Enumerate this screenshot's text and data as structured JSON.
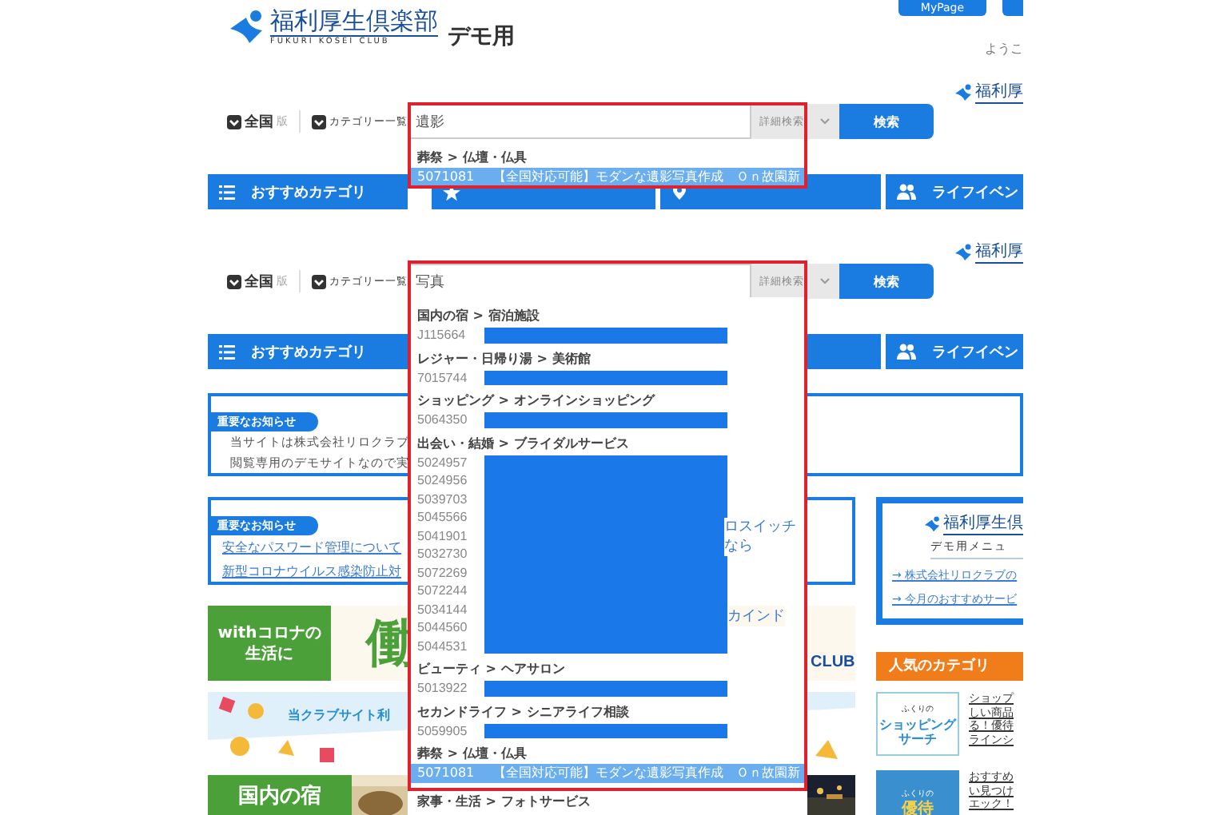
{
  "top": {
    "logo": {
      "name": "福利厚生倶楽部",
      "tagline": "FUKURI KOSEI CLUB"
    },
    "edition": "デモ用",
    "mypage": "MyPage",
    "greeting": "ようこ",
    "side_logo": "福利厚",
    "filters": [
      {
        "label": "全国",
        "suffix": "版"
      },
      {
        "label": "カテゴリー一覧"
      }
    ],
    "search": {
      "value": "遺影",
      "mode": "詳細検索",
      "button": "検索"
    },
    "suggestions": [
      {
        "heading": "葬祭 > 仏壇・仏具",
        "items": [
          {
            "code": "5071081",
            "title": "【全国対応可能】モダンな遺影写真作成　Ｏｎ故園新",
            "redacted": false,
            "selected": true
          }
        ]
      }
    ],
    "nav": {
      "labels": [
        "おすすめカテゴリ",
        "ライフイベン"
      ]
    }
  },
  "lower": {
    "side_logo": "福利厚",
    "filters": [
      {
        "label": "全国",
        "suffix": "版"
      },
      {
        "label": "カテゴリー一覧"
      }
    ],
    "search": {
      "value": "写真",
      "mode": "詳細検索",
      "button": "検索"
    },
    "suggestions": [
      {
        "heading": "国内の宿 > 宿泊施設",
        "items": [
          {
            "code": "J115664",
            "redacted": true,
            "selected": false
          }
        ]
      },
      {
        "heading": "レジャー・日帰り湯 > 美術館",
        "items": [
          {
            "code": "7015744",
            "redacted": true,
            "selected": false
          }
        ]
      },
      {
        "heading": "ショッピング > オンラインショッピング",
        "items": [
          {
            "code": "5064350",
            "redacted": true,
            "selected": false
          }
        ]
      },
      {
        "heading": "出会い・結婚 > ブライダルサービス",
        "items": [
          {
            "code": "5024957",
            "redacted": true,
            "selected": false
          },
          {
            "code": "5024956",
            "redacted": true,
            "selected": false
          },
          {
            "code": "5039703",
            "redacted": true,
            "selected": false
          },
          {
            "code": "5045566",
            "redacted": true,
            "selected": false
          },
          {
            "code": "5041901",
            "redacted": true,
            "selected": false
          },
          {
            "code": "5032730",
            "redacted": true,
            "selected": false
          },
          {
            "code": "5072269",
            "redacted": true,
            "selected": false
          },
          {
            "code": "5072244",
            "redacted": true,
            "selected": false
          },
          {
            "code": "5034144",
            "redacted": true,
            "selected": false
          },
          {
            "code": "5044560",
            "redacted": true,
            "selected": false
          },
          {
            "code": "5044531",
            "redacted": true,
            "selected": false
          }
        ]
      },
      {
        "heading": "ビューティ > ヘアサロン",
        "items": [
          {
            "code": "5013922",
            "redacted": true,
            "selected": false
          }
        ]
      },
      {
        "heading": "セカンドライフ > シニアライフ相談",
        "items": [
          {
            "code": "5059905",
            "redacted": true,
            "selected": false
          }
        ]
      },
      {
        "heading": "葬祭 > 仏壇・仏具",
        "items": [
          {
            "code": "5071081",
            "title": "【全国対応可能】モダンな遺影写真作成　Ｏｎ故園新",
            "redacted": false,
            "selected": true
          }
        ]
      }
    ],
    "more_heading": "家事・生活 > フォトサービス",
    "nav": {
      "labels": [
        "おすすめカテゴリ",
        "ライフイベン"
      ]
    },
    "notice": {
      "badge": "重要なお知らせ",
      "lines": [
        "当サイトは株式会社リロクラブ",
        "閲覧専用のデモサイトなので実"
      ]
    },
    "notice2": {
      "badge": "重要なお知らせ",
      "links": [
        "安全なパスワード管理について",
        "新型コロナウイルス感染防止対"
      ],
      "fragments": [
        "ロスイッチ",
        "なら"
      ]
    },
    "banner1": {
      "lines": [
        "withコロナの",
        "生活に"
      ],
      "headline": "働",
      "fragment": "カインド",
      "mark": "CLUB"
    },
    "banner2": {
      "text": "当クラブサイト利"
    },
    "banner3": {
      "text": "国内の宿"
    },
    "menu_card": {
      "logo": "福利厚生倶",
      "title": "デモ用メニュ",
      "links": [
        "→ 株式会社リロクラブの",
        "→ 今月のおすすめサービ"
      ]
    },
    "popular": {
      "title": "人気のカテゴリ",
      "items": [
        {
          "kind": "shopping",
          "icon_lines": [
            "ふくりの",
            "ショッピング",
            "サーチ"
          ],
          "lines": [
            "ショップ",
            "しい商品",
            "る！優待",
            "ラインシ"
          ]
        },
        {
          "kind": "benefit",
          "icon_lines": [
            "ふくりの",
            "優待"
          ],
          "lines": [
            "おすすめ",
            "い見つけ",
            "エック！"
          ]
        }
      ]
    }
  }
}
